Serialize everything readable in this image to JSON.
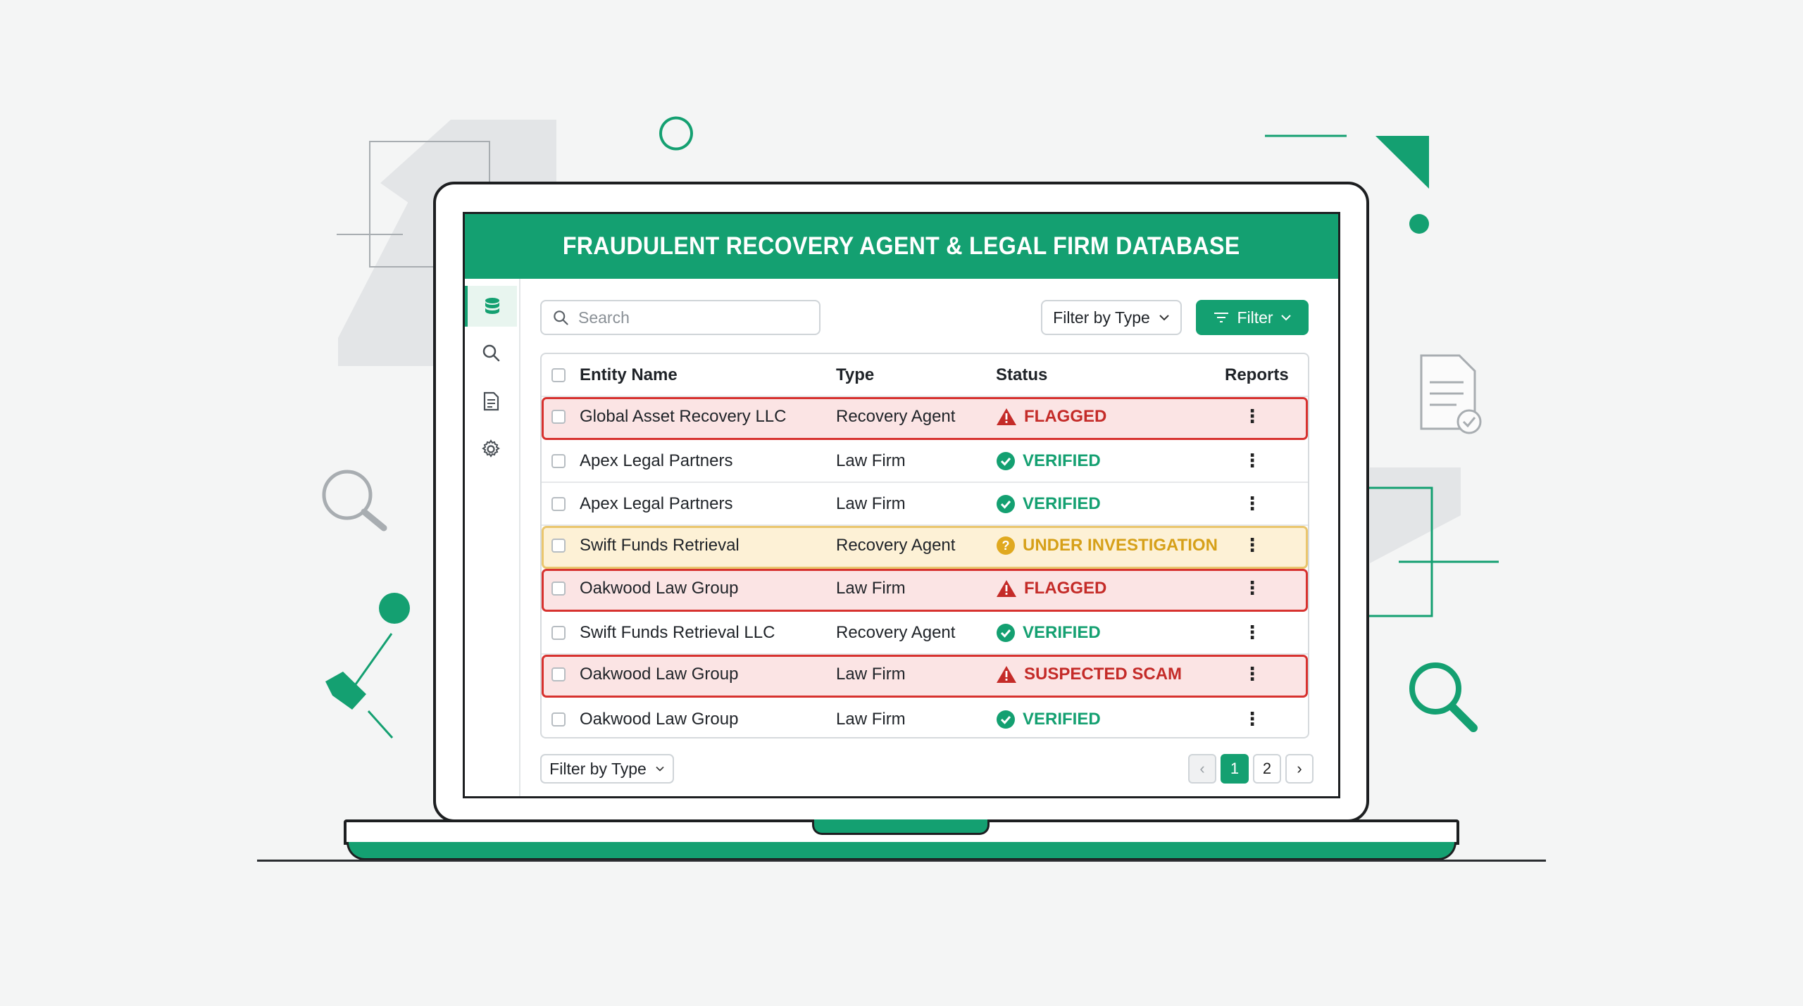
{
  "app": {
    "title": "FRAUDULENT RECOVERY AGENT & LEGAL FIRM DATABASE",
    "accent_color": "#14a071"
  },
  "sidebar": {
    "items": [
      {
        "icon": "database-icon",
        "active": true
      },
      {
        "icon": "search-icon",
        "active": false
      },
      {
        "icon": "document-icon",
        "active": false
      },
      {
        "icon": "gear-icon",
        "active": false
      }
    ]
  },
  "toolbar": {
    "search_placeholder": "Search",
    "type_filter_label": "Filter by Type",
    "filter_button_label": "Filter"
  },
  "table": {
    "columns": [
      "Entity Name",
      "Type",
      "Status",
      "Reports"
    ],
    "rows": [
      {
        "name": "Global Asset Recovery LLC",
        "type": "Recovery Agent",
        "status": "FLAGGED",
        "level": "danger"
      },
      {
        "name": "Apex Legal Partners",
        "type": "Law Firm",
        "status": "VERIFIED",
        "level": "ok"
      },
      {
        "name": "Apex Legal Partners",
        "type": "Law Firm",
        "status": "VERIFIED",
        "level": "ok"
      },
      {
        "name": "Swift Funds Retrieval",
        "type": "Recovery Agent",
        "status": "UNDER INVESTIGATION",
        "level": "warning"
      },
      {
        "name": "Oakwood Law Group",
        "type": "Law Firm",
        "status": "FLAGGED",
        "level": "danger"
      },
      {
        "name": "Swift Funds Retrieval LLC",
        "type": "Recovery Agent",
        "status": "VERIFIED",
        "level": "ok"
      },
      {
        "name": "Oakwood Law Group",
        "type": "Law Firm",
        "status": "SUSPECTED SCAM",
        "level": "danger"
      },
      {
        "name": "Oakwood Law Group",
        "type": "Law Firm",
        "status": "VERIFIED",
        "level": "ok"
      }
    ],
    "row_action": "⋮"
  },
  "footer": {
    "type_filter_label": "Filter by Type",
    "pagination": {
      "prev": "‹",
      "pages": [
        "1",
        "2"
      ],
      "current": "1",
      "next": "›"
    }
  },
  "status_colors": {
    "danger": "#c42b28",
    "ok": "#14a071",
    "warning": "#d6a019"
  }
}
